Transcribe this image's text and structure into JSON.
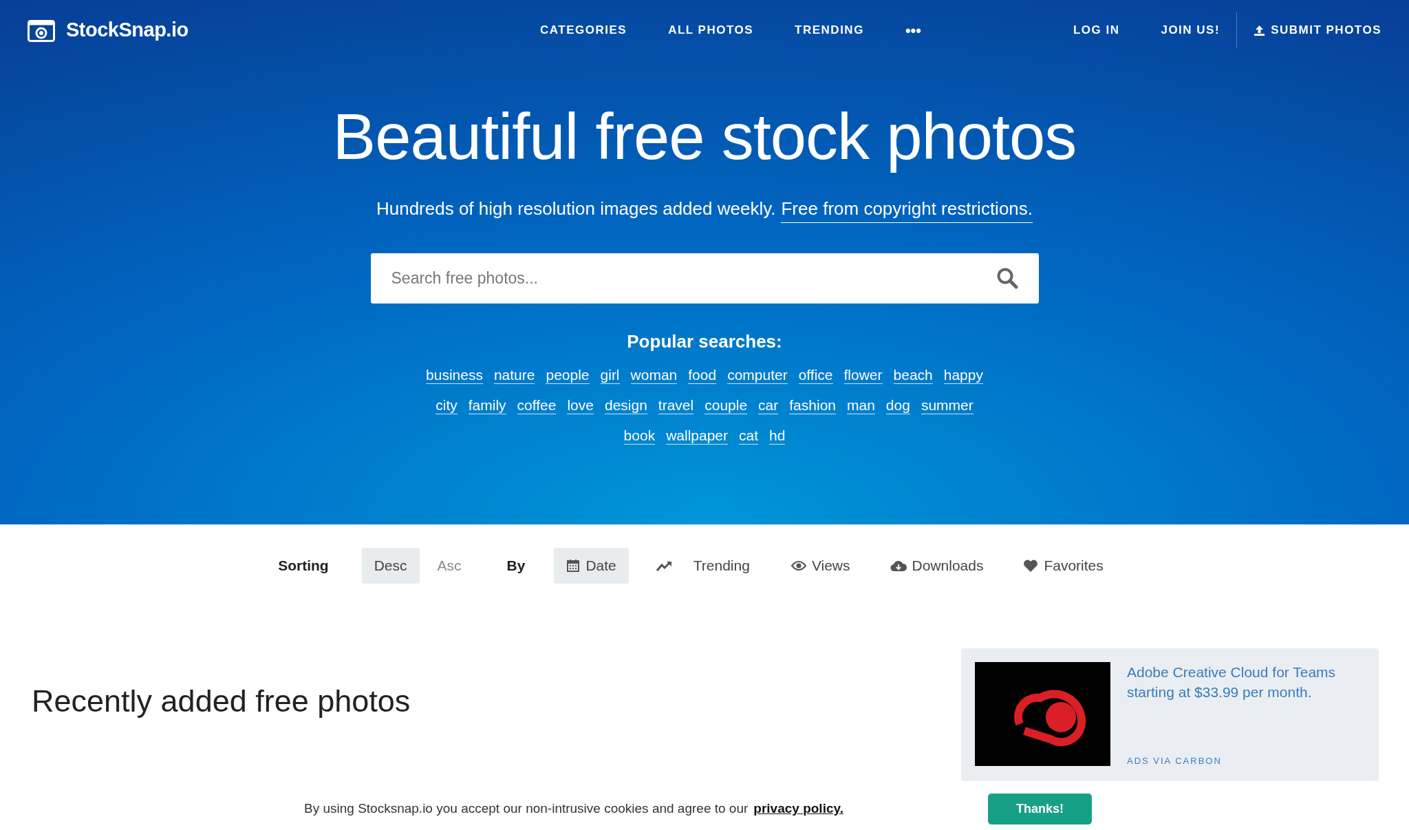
{
  "navbar": {
    "logo": "StockSnap.io",
    "links": [
      "CATEGORIES",
      "ALL PHOTOS",
      "TRENDING"
    ],
    "more": "•••",
    "account": [
      "LOG IN",
      "JOIN US!"
    ],
    "submit": "SUBMIT PHOTOS"
  },
  "hero": {
    "title": "Beautiful free stock photos",
    "subtitle": "Hundreds of high resolution images added weekly.",
    "subtitle_link": "Free from copyright restrictions.",
    "search": {
      "placeholder": "Search free photos..."
    },
    "popular_title": "Popular searches:",
    "tag_rows": [
      [
        "business",
        "nature",
        "people",
        "girl",
        "woman",
        "food",
        "computer",
        "office",
        "flower",
        "beach",
        "happy"
      ],
      [
        "city",
        "family",
        "coffee",
        "love",
        "design",
        "travel",
        "couple",
        "car",
        "fashion",
        "man",
        "dog",
        "summer"
      ],
      [
        "book",
        "wallpaper",
        "cat",
        "hd"
      ]
    ]
  },
  "sorting": {
    "label": "Sorting",
    "order": [
      {
        "label": "Desc",
        "selected": true
      },
      {
        "label": "Asc",
        "selected": false
      }
    ],
    "by_label": "By",
    "by": [
      {
        "kind": "calendar",
        "label": "Date",
        "selected": true
      },
      {
        "kind": "trend",
        "label": "Trending",
        "selected": false
      },
      {
        "kind": "eye",
        "label": "Views",
        "selected": false
      },
      {
        "kind": "download",
        "label": "Downloads",
        "selected": false
      },
      {
        "kind": "heart",
        "label": "Favorites",
        "selected": false
      }
    ]
  },
  "section_title": "Recently added free photos",
  "ad": {
    "text": "Adobe Creative Cloud for Teams starting at $33.99 per month.",
    "footer": "ADS VIA CARBON"
  },
  "cookie_bar": {
    "text": "By using Stocksnap.io you accept our non-intrusive cookies and agree to our",
    "link": "privacy policy.",
    "button": "Thanks!"
  }
}
